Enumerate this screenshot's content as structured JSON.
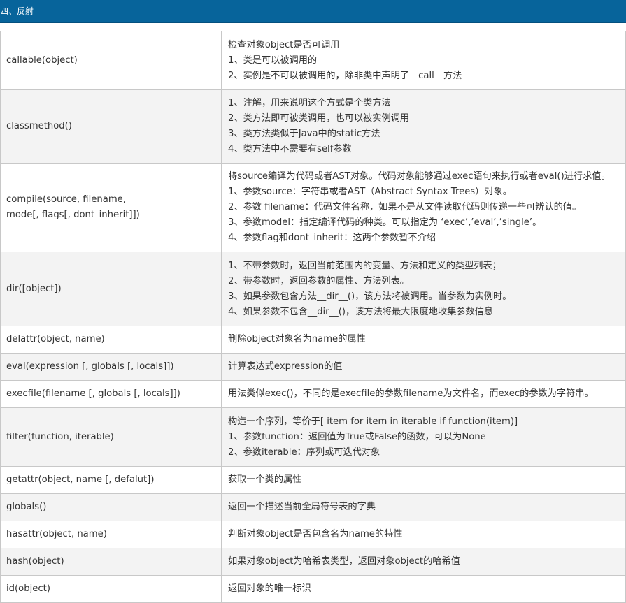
{
  "header": {
    "title": "四、反射"
  },
  "rows": [
    {
      "function": [
        "callable(object)"
      ],
      "description": [
        "检查对象object是否可调用",
        "1、类是可以被调用的",
        "2、实例是不可以被调用的，除非类中声明了__call__方法"
      ]
    },
    {
      "function": [
        "classmethod()"
      ],
      "description": [
        "1、注解，用来说明这个方式是个类方法",
        "2、类方法即可被类调用，也可以被实例调用",
        "3、类方法类似于Java中的static方法",
        "4、类方法中不需要有self参数"
      ]
    },
    {
      "function": [
        "compile(source, filename,",
        "mode[, flags[, dont_inherit]])"
      ],
      "description": [
        "将source编译为代码或者AST对象。代码对象能够通过exec语句来执行或者eval()进行求值。",
        "1、参数source：字符串或者AST（Abstract Syntax Trees）对象。",
        "2、参数 filename：代码文件名称，如果不是从文件读取代码则传递一些可辨认的值。",
        "3、参数model：指定编译代码的种类。可以指定为 ‘exec’,’eval’,’single’。",
        "4、参数flag和dont_inherit：这两个参数暂不介绍"
      ]
    },
    {
      "function": [
        "dir([object])"
      ],
      "description": [
        "1、不带参数时，返回当前范围内的变量、方法和定义的类型列表；",
        "2、带参数时，返回参数的属性、方法列表。",
        "3、如果参数包含方法__dir__()，该方法将被调用。当参数为实例时。",
        "4、如果参数不包含__dir__()，该方法将最大限度地收集参数信息"
      ]
    },
    {
      "function": [
        "delattr(object, name)"
      ],
      "description": [
        "删除object对象名为name的属性"
      ]
    },
    {
      "function": [
        "eval(expression [, globals [, locals]])"
      ],
      "description": [
        "计算表达式expression的值"
      ]
    },
    {
      "function": [
        "execfile(filename [, globals [, locals]])"
      ],
      "description": [
        "用法类似exec()，不同的是execfile的参数filename为文件名，而exec的参数为字符串。"
      ]
    },
    {
      "function": [
        "filter(function, iterable)"
      ],
      "description": [
        "构造一个序列，等价于[ item for item in iterable if function(item)]",
        "1、参数function：返回值为True或False的函数，可以为None",
        "2、参数iterable：序列或可迭代对象"
      ]
    },
    {
      "function": [
        "getattr(object, name [, defalut])"
      ],
      "description": [
        "获取一个类的属性"
      ]
    },
    {
      "function": [
        "globals()"
      ],
      "description": [
        "返回一个描述当前全局符号表的字典"
      ]
    },
    {
      "function": [
        "hasattr(object, name)"
      ],
      "description": [
        "判断对象object是否包含名为name的特性"
      ]
    },
    {
      "function": [
        "hash(object)"
      ],
      "description": [
        "如果对象object为哈希表类型，返回对象object的哈希值"
      ]
    },
    {
      "function": [
        "id(object)"
      ],
      "description": [
        "返回对象的唯一标识"
      ]
    }
  ]
}
